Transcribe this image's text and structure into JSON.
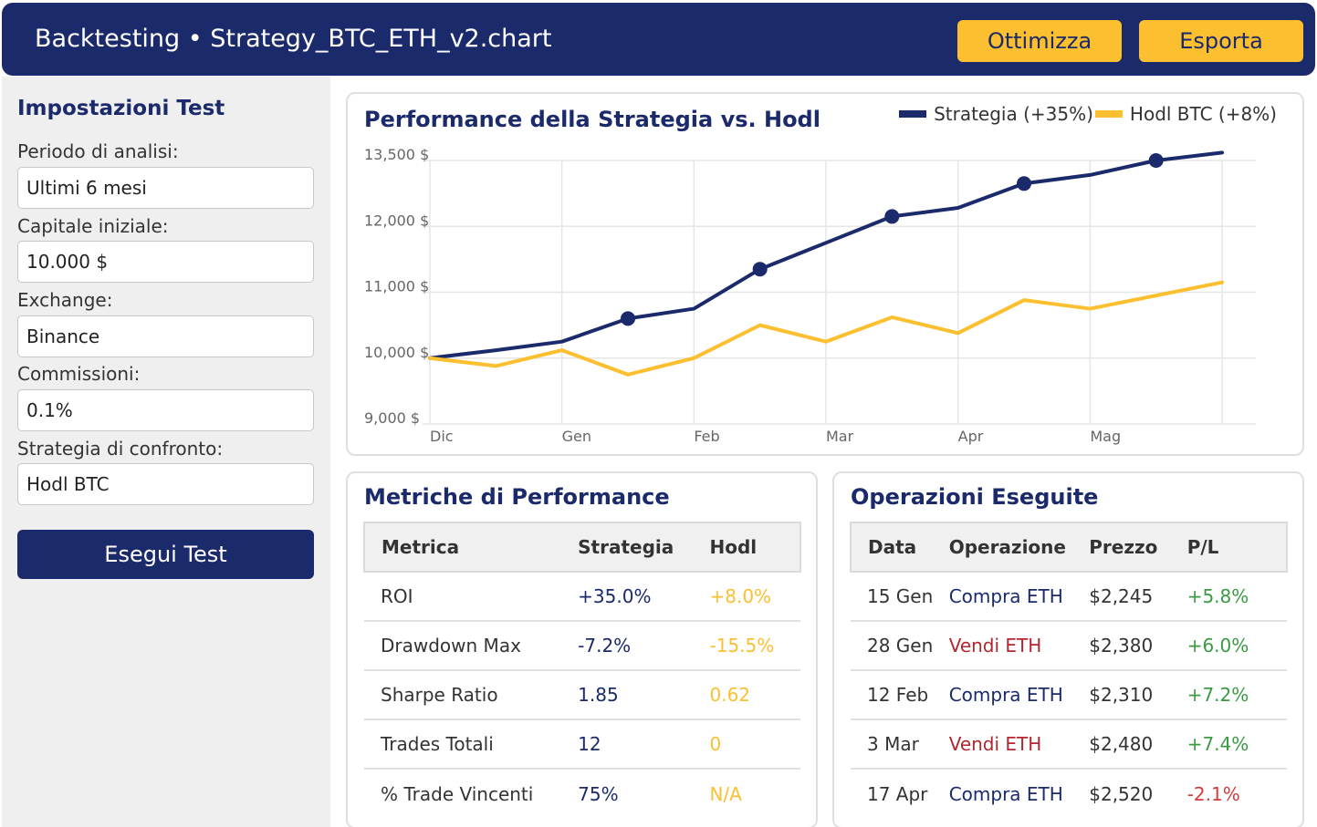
{
  "header": {
    "title": "Backtesting • Strategy_BTC_ETH_v2.chart",
    "buttons": {
      "optimize": "Ottimizza",
      "export": "Esporta"
    }
  },
  "sidebar": {
    "title": "Impostazioni Test",
    "fields": [
      {
        "label": "Periodo di analisi:",
        "value": "Ultimi 6 mesi"
      },
      {
        "label": "Capitale iniziale:",
        "value": "10.000 $"
      },
      {
        "label": "Exchange:",
        "value": "Binance"
      },
      {
        "label": "Commissioni:",
        "value": "0.1%"
      },
      {
        "label": "Strategia di confronto:",
        "value": "Hodl BTC"
      }
    ],
    "run_button": "Esegui Test"
  },
  "chart_card": {
    "title": "Performance della Strategia vs. Hodl"
  },
  "chart_data": {
    "type": "line",
    "title": "Performance della Strategia vs. Hodl",
    "x": [
      "Dic",
      "",
      "Gen",
      "",
      "Feb",
      "",
      "Mar",
      "",
      "Apr",
      "",
      "Mag",
      "",
      ""
    ],
    "x_tick_labels": [
      "Dic",
      "Gen",
      "Feb",
      "Mar",
      "Apr",
      "Mag"
    ],
    "y_tick_labels": [
      "9,000 $",
      "10,000 $",
      "11,000 $",
      "12,000 $",
      "13,500 $"
    ],
    "y_ticks": [
      9000,
      10000,
      11000,
      12000,
      13000
    ],
    "ylim": [
      9000,
      13000
    ],
    "grid": true,
    "legend_position": "top-right",
    "series": [
      {
        "name": "Strategia (+35%)",
        "color": "#1b2a6b",
        "values": [
          10000,
          10120,
          10250,
          10600,
          10750,
          11350,
          11750,
          12150,
          12280,
          12650,
          12780,
          13000,
          13120
        ],
        "markers": [
          3,
          5,
          7,
          9,
          11
        ]
      },
      {
        "name": "Hodl BTC (+8%)",
        "color": "#fcbf2f",
        "values": [
          10000,
          9880,
          10120,
          9750,
          10000,
          10500,
          10250,
          10620,
          10380,
          10880,
          10750,
          10950,
          11150
        ]
      }
    ]
  },
  "metrics": {
    "title": "Metriche di Performance",
    "headers": [
      "Metrica",
      "Strategia",
      "Hodl"
    ],
    "rows": [
      [
        "ROI",
        "+35.0%",
        "+8.0%"
      ],
      [
        "Drawdown Max",
        "-7.2%",
        "-15.5%"
      ],
      [
        "Sharpe Ratio",
        "1.85",
        "0.62"
      ],
      [
        "Trades Totali",
        "12",
        "0"
      ],
      [
        "% Trade Vincenti",
        "75%",
        "N/A"
      ]
    ]
  },
  "trades": {
    "title": "Operazioni Eseguite",
    "headers": [
      "Data",
      "Operazione",
      "Prezzo",
      "P/L"
    ],
    "rows": [
      [
        "15 Gen",
        "Compra ETH",
        "$2,245",
        "+5.8%"
      ],
      [
        "28 Gen",
        "Vendi ETH",
        "$2,380",
        "+6.0%"
      ],
      [
        "12 Feb",
        "Compra ETH",
        "$2,310",
        "+7.2%"
      ],
      [
        "3 Mar",
        "Vendi ETH",
        "$2,480",
        "+7.4%"
      ],
      [
        "17 Apr",
        "Compra ETH",
        "$2,520",
        "-2.1%"
      ]
    ]
  },
  "colors": {
    "navy": "#1b2a6b",
    "yellow": "#fcbf2f",
    "buy": "#1b2a6b",
    "sell": "#b3262f",
    "positive": "#3a9a42",
    "negative": "#d33a3a"
  }
}
